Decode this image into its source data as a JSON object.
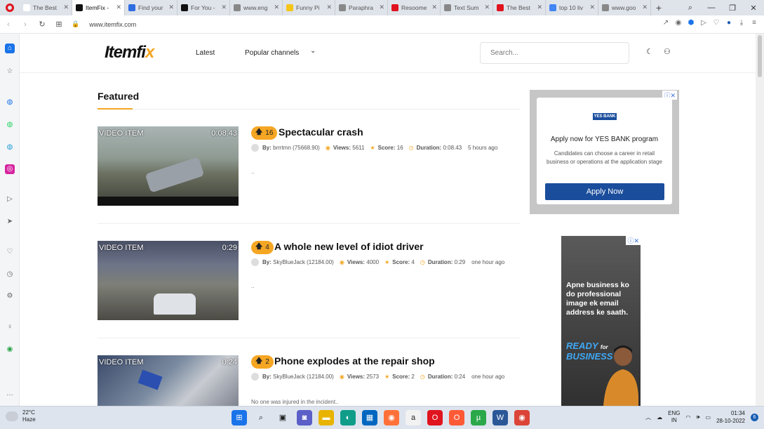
{
  "browser": {
    "tabs": [
      {
        "label": "The Best",
        "color": "#ffffff"
      },
      {
        "label": "ItemFix -",
        "color": "#111111",
        "active": true
      },
      {
        "label": "Find your",
        "color": "#2f6de1"
      },
      {
        "label": "For You -",
        "color": "#111111"
      },
      {
        "label": "www.eng",
        "color": "#888888"
      },
      {
        "label": "Funny Pi",
        "color": "#f5c518"
      },
      {
        "label": "Paraphra",
        "color": "#888888"
      },
      {
        "label": "Resoome",
        "color": "#e0141e"
      },
      {
        "label": "Text Sum",
        "color": "#888888"
      },
      {
        "label": "The Best",
        "color": "#e0141e"
      },
      {
        "label": "top 10 liv",
        "color": "#4285f4"
      },
      {
        "label": "www.goo",
        "color": "#888888"
      }
    ],
    "url": "www.itemfix.com"
  },
  "site": {
    "logo_main": "Itemfi",
    "logo_x": "x",
    "nav_latest": "Latest",
    "nav_popular": "Popular channels",
    "search_placeholder": "Search..."
  },
  "featured_heading": "Featured",
  "items": [
    {
      "tag": "VIDEO ITEM",
      "duration_overlay": "0:08.43",
      "votes": "16",
      "title": "Spectacular crash",
      "by_label": "By:",
      "author": "brrrtmn (75668.90)",
      "views_label": "Views:",
      "views": "5611",
      "score_label": "Score:",
      "score": "16",
      "duration_label": "Duration:",
      "duration": "0:08.43",
      "ago": "5 hours ago",
      "desc": ".."
    },
    {
      "tag": "VIDEO ITEM",
      "duration_overlay": "0:29",
      "votes": "4",
      "title": "A whole new level of idiot driver",
      "by_label": "By:",
      "author": "SkyBlueJack (12184.00)",
      "views_label": "Views:",
      "views": "4000",
      "score_label": "Score:",
      "score": "4",
      "duration_label": "Duration:",
      "duration": "0:29",
      "ago": "one hour ago",
      "desc": ".."
    },
    {
      "tag": "VIDEO ITEM",
      "duration_overlay": "0:24",
      "votes": "2",
      "title": "Phone explodes at the repair shop",
      "by_label": "By:",
      "author": "SkyBlueJack (12184.00)",
      "views_label": "Views:",
      "views": "2573",
      "score_label": "Score:",
      "score": "2",
      "duration_label": "Duration:",
      "duration": "0:24",
      "ago": "one hour ago",
      "desc": "No one was injured in the incident.."
    }
  ],
  "ad1": {
    "logo": "YES BANK",
    "headline": "Apply now for YES BANK program",
    "body": "Candidates can choose a career in retail business or operations at the application stage",
    "button": "Apply Now"
  },
  "ad2": {
    "text": "Apne business ko do professional image ek email address ke saath.",
    "brand_line1": "READY",
    "brand_for": "for",
    "brand_line2": "BUSINESS"
  },
  "taskbar": {
    "temp": "22°C",
    "weather": "Haze",
    "lang1": "ENG",
    "lang2": "IN",
    "time": "01:34",
    "date": "28-10-2022",
    "notif_count": "6"
  }
}
